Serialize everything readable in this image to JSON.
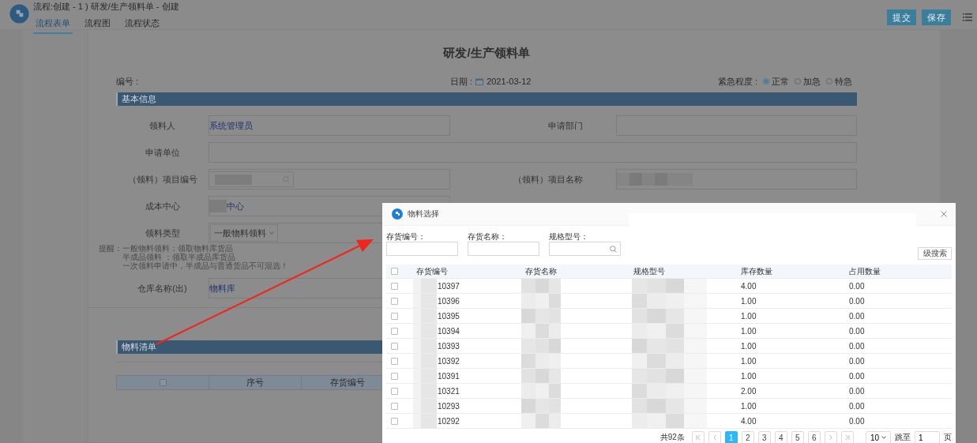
{
  "window": {
    "title": "流程:创建 - 1 ) 研发/生产领料单 - 创建"
  },
  "tabs": [
    {
      "label": "流程表单",
      "selected": true
    },
    {
      "label": "流程图",
      "selected": false
    },
    {
      "label": "流程状态",
      "selected": false
    }
  ],
  "actions": [
    "提交",
    "保存"
  ],
  "form": {
    "title": "研发/生产领料单",
    "number_label": "编号 :",
    "date_label": "日期 :",
    "date": "2021-03-12",
    "urgency_label": "紧急程度 :",
    "urgency": [
      {
        "label": "正常",
        "selected": true
      },
      {
        "label": "加急",
        "selected": false
      },
      {
        "label": "特急",
        "selected": false
      }
    ],
    "basic_heading": "基本信息",
    "rows": [
      [
        {
          "label": "领料人",
          "value": "系统管理员",
          "kind": "text"
        },
        {
          "label": "申请部门",
          "kind": "text"
        }
      ],
      [
        {
          "label": "申请单位",
          "kind": "wide"
        }
      ],
      [
        {
          "label": "（领料）项目编号",
          "kind": "search",
          "masked": true
        },
        {
          "label": "（领料）项目名称",
          "kind": "text",
          "masked": true
        }
      ],
      [
        {
          "label": "成本中心",
          "value": "中心",
          "kind": "text",
          "masked": true
        }
      ],
      [
        {
          "label": "领料类型",
          "value": "一般物料领料",
          "kind": "select"
        }
      ]
    ],
    "hint_label": "提醒：",
    "hints": [
      "一般物料领料：领取物料库货品",
      "半成品领料 ：领取半成品库货品",
      "一次领料申请中，半成品与普通货品不可混选！"
    ],
    "warehouse": {
      "label": "仓库名称(出)",
      "value": "物料库"
    },
    "list_heading": "物料清单",
    "list_header_checked": false,
    "list_columns": [
      "序号",
      "存货编号"
    ]
  },
  "dialog": {
    "title": "物料选择",
    "filters": [
      {
        "label": "存货编号：",
        "kind": "text"
      },
      {
        "label": "存货名称：",
        "kind": "text"
      },
      {
        "label": "规格型号：",
        "kind": "search"
      }
    ],
    "advanced_button": "级搜索",
    "header_checked": false,
    "columns": [
      "存货编号",
      "存货名称",
      "规格型号",
      "库存数量",
      "占用数量"
    ],
    "rows": [
      {
        "code": "10397",
        "stock": "4.00",
        "used": "0.00",
        "checked": false
      },
      {
        "code": "10396",
        "stock": "1.00",
        "used": "0.00",
        "checked": false
      },
      {
        "code": "10395",
        "stock": "1.00",
        "used": "0.00",
        "checked": false
      },
      {
        "code": "10394",
        "stock": "1.00",
        "used": "0.00",
        "checked": false
      },
      {
        "code": "10393",
        "stock": "1.00",
        "used": "0.00",
        "checked": false
      },
      {
        "code": "10392",
        "stock": "1.00",
        "used": "0.00",
        "checked": false
      },
      {
        "code": "10391",
        "stock": "1.00",
        "used": "0.00",
        "checked": false
      },
      {
        "code": "10321",
        "stock": "2.00",
        "used": "0.00",
        "checked": false
      },
      {
        "code": "10293",
        "stock": "1.00",
        "used": "0.00",
        "checked": false
      },
      {
        "code": "10292",
        "stock": "4.00",
        "used": "0.00",
        "checked": false
      }
    ],
    "pagination": {
      "total": "共92条",
      "pages": [
        {
          "label": "1",
          "selected": true
        },
        {
          "label": "2",
          "selected": false
        },
        {
          "label": "3",
          "selected": false
        },
        {
          "label": "4",
          "selected": false
        },
        {
          "label": "5",
          "selected": false
        },
        {
          "label": "6",
          "selected": false
        }
      ],
      "page_size": "10",
      "jump_label": "跳至",
      "jump_value": "1",
      "suffix": "页"
    }
  }
}
